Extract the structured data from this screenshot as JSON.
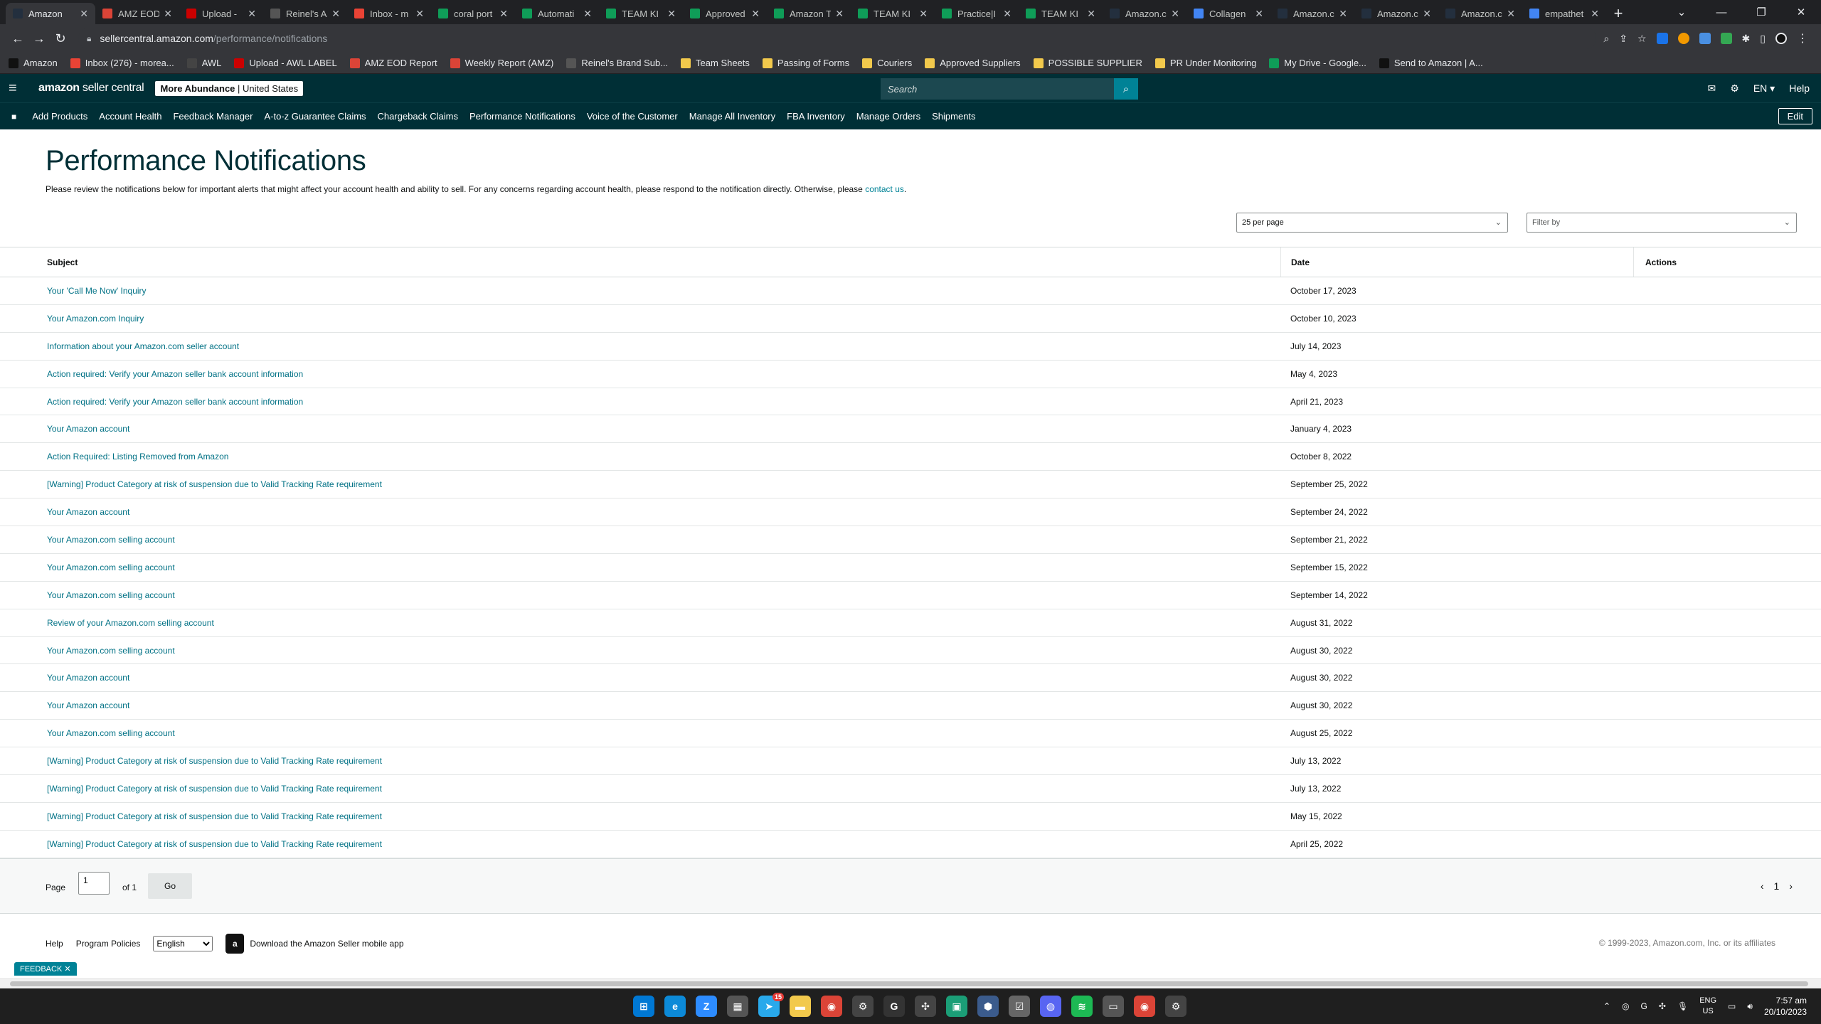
{
  "browser": {
    "tabs": [
      {
        "label": "Amazon",
        "active": true,
        "icon": "amazon-icon",
        "color": "#232f3e"
      },
      {
        "label": "AMZ EOD",
        "icon": "multicolor-icon",
        "color": "#db4437"
      },
      {
        "label": "Upload -",
        "icon": "upload-icon",
        "color": "#c00"
      },
      {
        "label": "Reinel's A",
        "icon": "wm-icon",
        "color": "#555"
      },
      {
        "label": "Inbox - m",
        "icon": "gmail-icon",
        "color": "#ea4335"
      },
      {
        "label": "coral port",
        "icon": "drive-icon",
        "color": "#0f9d58"
      },
      {
        "label": "Automati",
        "icon": "sheets-icon",
        "color": "#0f9d58"
      },
      {
        "label": "TEAM KI",
        "icon": "sheets-icon",
        "color": "#0f9d58"
      },
      {
        "label": "Approved",
        "icon": "sheets-icon",
        "color": "#0f9d58"
      },
      {
        "label": "Amazon T",
        "icon": "sheets-icon",
        "color": "#0f9d58"
      },
      {
        "label": "TEAM KI",
        "icon": "sheets-icon",
        "color": "#0f9d58"
      },
      {
        "label": "Practice|I",
        "icon": "sheets-icon",
        "color": "#0f9d58"
      },
      {
        "label": "TEAM KI",
        "icon": "sheets-icon",
        "color": "#0f9d58"
      },
      {
        "label": "Amazon.c",
        "icon": "amazon-icon",
        "color": "#232f3e"
      },
      {
        "label": "Collagen",
        "icon": "google-icon",
        "color": "#4285f4"
      },
      {
        "label": "Amazon.c",
        "icon": "amazon-icon",
        "color": "#232f3e"
      },
      {
        "label": "Amazon.c",
        "icon": "amazon-icon",
        "color": "#232f3e"
      },
      {
        "label": "Amazon.c",
        "icon": "amazon-icon",
        "color": "#232f3e"
      },
      {
        "label": "empathet",
        "icon": "google-icon",
        "color": "#4285f4"
      }
    ],
    "url_host": "sellercentral.amazon.com",
    "url_path": "/performance/notifications",
    "bookmarks": [
      {
        "label": "Amazon",
        "icon": "amazon-icon",
        "color": "#111"
      },
      {
        "label": "Inbox (276) - morea...",
        "icon": "gmail-icon",
        "color": "#ea4335"
      },
      {
        "label": "AWL",
        "icon": "awl-icon",
        "color": "#444"
      },
      {
        "label": "Upload - AWL LABEL",
        "icon": "upload-icon",
        "color": "#c00"
      },
      {
        "label": "AMZ EOD Report",
        "icon": "multicolor-icon",
        "color": "#db4437"
      },
      {
        "label": "Weekly Report (AMZ)",
        "icon": "multicolor-icon",
        "color": "#db4437"
      },
      {
        "label": "Reinel's Brand Sub...",
        "icon": "wm-icon",
        "color": "#555"
      },
      {
        "label": "Team Sheets",
        "icon": "folder-icon",
        "color": "#f2c94c"
      },
      {
        "label": "Passing of Forms",
        "icon": "folder-icon",
        "color": "#f2c94c"
      },
      {
        "label": "Couriers",
        "icon": "folder-icon",
        "color": "#f2c94c"
      },
      {
        "label": "Approved Suppliers",
        "icon": "folder-icon",
        "color": "#f2c94c"
      },
      {
        "label": "POSSIBLE SUPPLIER",
        "icon": "folder-icon",
        "color": "#f2c94c"
      },
      {
        "label": "PR Under Monitoring",
        "icon": "folder-icon",
        "color": "#f2c94c"
      },
      {
        "label": "My Drive - Google...",
        "icon": "drive-icon",
        "color": "#0f9d58"
      },
      {
        "label": "Send to Amazon | A...",
        "icon": "amazon-icon",
        "color": "#111"
      }
    ]
  },
  "header": {
    "logo_bold": "amazon",
    "logo_rest": " seller central",
    "store_name": "More Abundance",
    "store_region": "United States",
    "search_placeholder": "Search",
    "lang": "EN",
    "help": "Help"
  },
  "nav": {
    "items": [
      "Add Products",
      "Account Health",
      "Feedback Manager",
      "A-to-z Guarantee Claims",
      "Chargeback Claims",
      "Performance Notifications",
      "Voice of the Customer",
      "Manage All Inventory",
      "FBA Inventory",
      "Manage Orders",
      "Shipments"
    ],
    "edit": "Edit"
  },
  "page": {
    "title": "Performance Notifications",
    "desc": "Please review the notifications below for important alerts that might affect your account health and ability to sell. For any concerns regarding account health, please respond to the notification directly. Otherwise, please ",
    "contact": "contact us",
    "per_page": "25 per page",
    "filter": "Filter by"
  },
  "table": {
    "headers": {
      "subject": "Subject",
      "date": "Date",
      "actions": "Actions"
    },
    "rows": [
      {
        "subject": "Your 'Call Me Now' Inquiry",
        "date": "October 17, 2023"
      },
      {
        "subject": "Your Amazon.com Inquiry",
        "date": "October 10, 2023"
      },
      {
        "subject": "Information about your Amazon.com seller account",
        "date": "July 14, 2023"
      },
      {
        "subject": "Action required: Verify your Amazon seller bank account information",
        "date": "May 4, 2023"
      },
      {
        "subject": "Action required: Verify your Amazon seller bank account information",
        "date": "April 21, 2023"
      },
      {
        "subject": "Your Amazon account",
        "date": "January 4, 2023"
      },
      {
        "subject": "Action Required: Listing Removed from Amazon",
        "date": "October 8, 2022"
      },
      {
        "subject": "[Warning] Product Category at risk of suspension due to Valid Tracking Rate requirement",
        "date": "September 25, 2022"
      },
      {
        "subject": "Your Amazon account",
        "date": "September 24, 2022"
      },
      {
        "subject": "Your Amazon.com selling account",
        "date": "September 21, 2022"
      },
      {
        "subject": "Your Amazon.com selling account",
        "date": "September 15, 2022"
      },
      {
        "subject": "Your Amazon.com selling account",
        "date": "September 14, 2022"
      },
      {
        "subject": "Review of your Amazon.com selling account",
        "date": "August 31, 2022"
      },
      {
        "subject": "Your Amazon.com selling account",
        "date": "August 30, 2022"
      },
      {
        "subject": "Your Amazon account",
        "date": "August 30, 2022"
      },
      {
        "subject": "Your Amazon account",
        "date": "August 30, 2022"
      },
      {
        "subject": "Your Amazon.com selling account",
        "date": "August 25, 2022"
      },
      {
        "subject": "[Warning] Product Category at risk of suspension due to Valid Tracking Rate requirement",
        "date": "July 13, 2022"
      },
      {
        "subject": "[Warning] Product Category at risk of suspension due to Valid Tracking Rate requirement",
        "date": "July 13, 2022"
      },
      {
        "subject": "[Warning] Product Category at risk of suspension due to Valid Tracking Rate requirement",
        "date": "May 15, 2022"
      },
      {
        "subject": "[Warning] Product Category at risk of suspension due to Valid Tracking Rate requirement",
        "date": "April 25, 2022"
      }
    ]
  },
  "pager": {
    "page_label": "Page",
    "page_value": "1",
    "of": "of 1",
    "go": "Go",
    "current": "1"
  },
  "footer": {
    "help": "Help",
    "policies": "Program Policies",
    "language": "English",
    "app": "Download the Amazon Seller mobile app",
    "copyright": "© 1999-2023, Amazon.com, Inc. or its affiliates"
  },
  "feedback": "FEEDBACK",
  "taskbar": {
    "apps": [
      {
        "icon": "windows-icon",
        "color": "#0078d4",
        "glyph": "⊞"
      },
      {
        "icon": "edge-icon",
        "color": "#0c8ad8",
        "glyph": "e"
      },
      {
        "icon": "zoom-icon",
        "color": "#2d8cff",
        "glyph": "Z"
      },
      {
        "icon": "calculator-icon",
        "color": "#555",
        "glyph": "▦"
      },
      {
        "icon": "telegram-icon",
        "color": "#29a9eb",
        "glyph": "➤"
      },
      {
        "icon": "file-explorer-icon",
        "color": "#f2c94c",
        "glyph": "▬"
      },
      {
        "icon": "chrome-icon",
        "color": "#db4437",
        "glyph": "◉"
      },
      {
        "icon": "settings-icon",
        "color": "#444",
        "glyph": "⚙"
      },
      {
        "icon": "grammarly-icon",
        "color": "#333",
        "glyph": "G"
      },
      {
        "icon": "pinwheel-icon",
        "color": "#444",
        "glyph": "✣"
      },
      {
        "icon": "app-icon",
        "color": "#1b9e77",
        "glyph": "▣"
      },
      {
        "icon": "box-icon",
        "color": "#3b5b8c",
        "glyph": "⬢"
      },
      {
        "icon": "checklist-icon",
        "color": "#666",
        "glyph": "☑"
      },
      {
        "icon": "discord-icon",
        "color": "#5865f2",
        "glyph": "◍"
      },
      {
        "icon": "spotify-icon",
        "color": "#1db954",
        "glyph": "≋"
      },
      {
        "icon": "window-icon",
        "color": "#555",
        "glyph": "▭"
      },
      {
        "icon": "chrome-icon",
        "color": "#db4437",
        "glyph": "◉"
      },
      {
        "icon": "settings-icon",
        "color": "#444",
        "glyph": "⚙"
      }
    ],
    "telegram_badge": "15",
    "lang_top": "ENG",
    "lang_bottom": "US",
    "time": "7:57 am",
    "date": "20/10/2023"
  }
}
